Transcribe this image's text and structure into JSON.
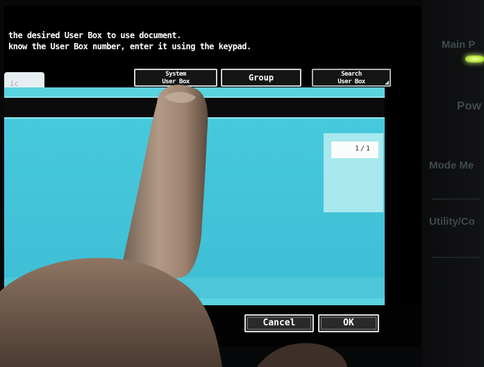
{
  "screen": {
    "instruction_line1": "the desired User Box to use document.",
    "instruction_line2": "know the User Box number, enter it using the keypad.",
    "tab_partial_label": "ic",
    "tabs": {
      "system_user_box_line1": "System",
      "system_user_box_line2": "User Box",
      "group": "Group",
      "search_user_box_line1": "Search",
      "search_user_box_line2": "User Box"
    },
    "scroll_indicator": "1/1",
    "buttons": {
      "cancel": "Cancel",
      "ok": "OK"
    }
  },
  "control_panel": {
    "main_power": "Main P",
    "power": "Pow",
    "mode_memory": "Mode Me",
    "utility_counter": "Utility/Co"
  },
  "colors": {
    "panel_cyan": "#59d3df",
    "screen_black": "#000000",
    "button_border": "#d8dde0",
    "led_green": "#b6e640"
  },
  "icons": {
    "led": "main-power-led"
  }
}
